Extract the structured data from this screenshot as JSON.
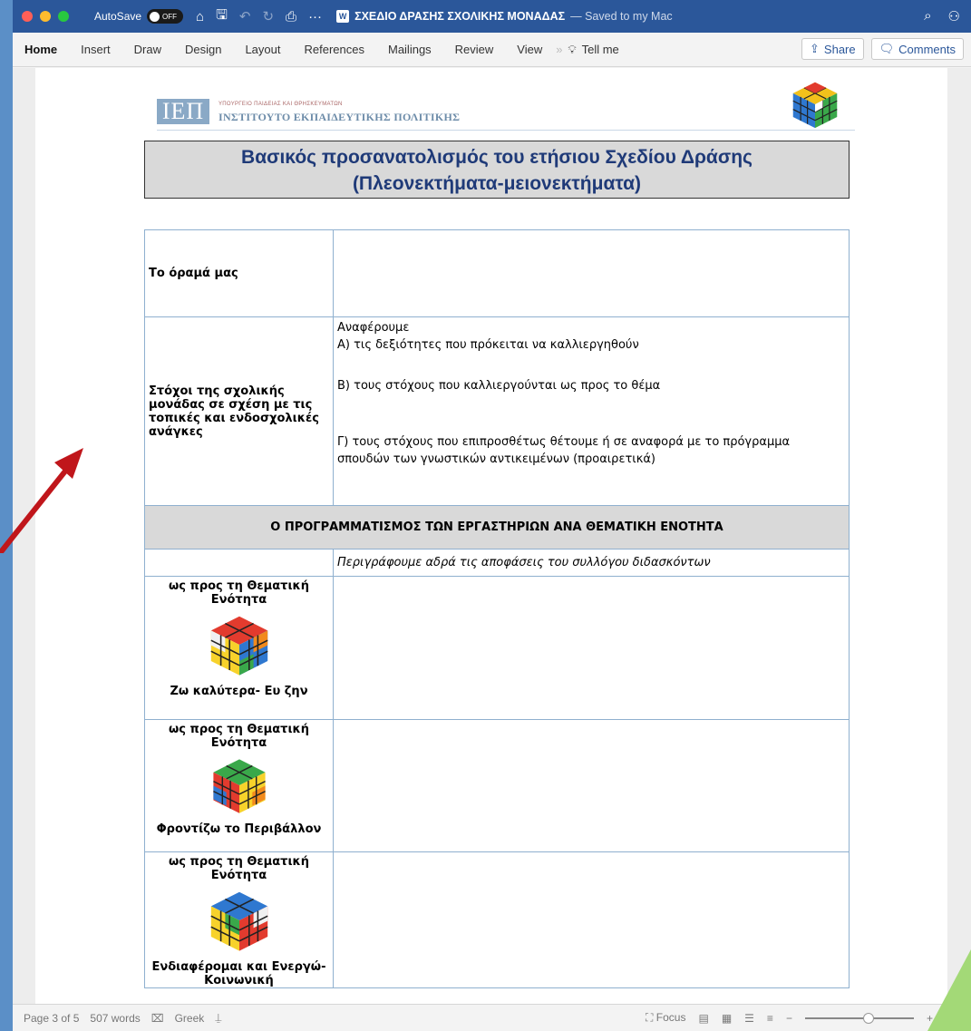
{
  "titlebar": {
    "autosave_label": "AutoSave",
    "autosave_state": "OFF",
    "doc_title": "ΣΧΕΔΙΟ ΔΡΑΣΗΣ ΣΧΟΛΙΚΗΣ ΜΟΝΑΔΑΣ",
    "saved_status": "— Saved to my Mac"
  },
  "ribbon": {
    "tabs": [
      "Home",
      "Insert",
      "Draw",
      "Design",
      "Layout",
      "References",
      "Mailings",
      "Review",
      "View"
    ],
    "tell_me": "Tell me",
    "share": "Share",
    "comments": "Comments"
  },
  "header": {
    "logo_letters": "ΙΕΠ",
    "logo_small": "ΥΠΟΥΡΓΕΙΟ ΠΑΙΔΕΙΑΣ ΚΑΙ ΘΡΗΣΚΕΥΜΑΤΩΝ",
    "logo_big": "ΙΝΣΤΙΤΟΥΤΟ ΕΚΠΑΙΔΕΥΤΙΚΗΣ ΠΟΛΙΤΙΚΗΣ"
  },
  "document": {
    "title_line1": "Βασικός προσανατολισμός του ετήσιου Σχεδίου Δράσης",
    "title_line2": "(Πλεονεκτήματα-μειονεκτήματα)",
    "vision_label": "Το όραμά μας",
    "goals_label": "Στόχοι της σχολικής μονάδας σε σχέση με τις τοπικές και ενδοσχολικές ανάγκες",
    "goals": {
      "intro": "Αναφέρουμε",
      "a": "Α) τις δεξιότητες που πρόκειται να καλλιεργηθούν",
      "b": "Β) τους στόχους που καλλιεργούνται ως προς το θέμα",
      "c": "Γ) τους στόχους που επιπροσθέτως θέτουμε ή σε αναφορά με το πρόγραμμα σπουδών  των γνωστικών αντικειμένων (προαιρετικά)"
    },
    "section_header": "Ο ΠΡΟΓΡΑΜΜΑΤΙΣΜΟΣ ΤΩΝ ΕΡΓΑΣΤΗΡΙΩΝ  ΑΝΑ ΘΕΜΑΤΙΚΗ ΕΝΟΤΗΤΑ",
    "describe_note": "Περιγράφουμε αδρά τις αποφάσεις του συλλόγου διδασκόντων",
    "themes": [
      {
        "prefix": "ως προς τη  Θεματική Ενότητα",
        "name": "Ζω καλύτερα- Ευ ζην"
      },
      {
        "prefix": "ως προς τη Θεματική Ενότητα",
        "name": "Φροντίζω το Περιβάλλον"
      },
      {
        "prefix": "ως προς τη Θεματική Ενότητα",
        "name": "Ενδιαφέρομαι και Ενεργώ- Κοινωνική"
      }
    ]
  },
  "statusbar": {
    "page": "Page 3 of 5",
    "words": "507 words",
    "language": "Greek",
    "focus": "Focus",
    "zoom": "150"
  },
  "colors": {
    "titlebar": "#2b579a",
    "heading_text": "#1f3a78",
    "arrow": "#c0161b",
    "corner_accent": "#a3d977"
  }
}
